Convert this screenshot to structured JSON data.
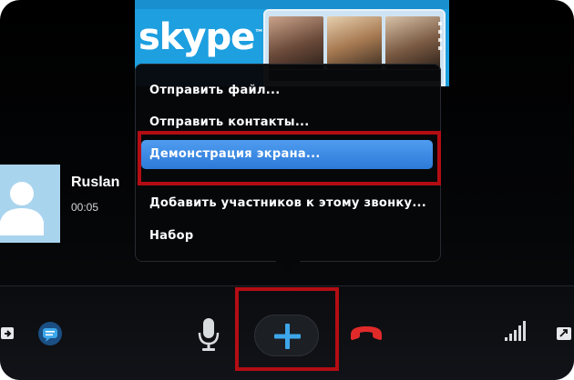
{
  "preview": {
    "logo_text": "skype",
    "logo_mark": "™"
  },
  "menu": {
    "items": [
      {
        "label": "Отправить файл..."
      },
      {
        "label": "Отправить контакты..."
      },
      {
        "label": "Демонстрация экрана...",
        "highlighted": true
      },
      {
        "label": "Добавить участников к этому звонку..."
      },
      {
        "label": "Набор"
      }
    ]
  },
  "participant": {
    "name": "Ruslan",
    "call_duration": "00:05"
  },
  "controls": {
    "icons": [
      "screen-share-icon",
      "chat-icon",
      "microphone-icon",
      "add-plus-icon",
      "hang-up-icon",
      "signal-strength-icon",
      "fullscreen-icon"
    ]
  },
  "colors": {
    "highlight": "#2c7ad8",
    "focus_box": "#b30d14",
    "add_plus": "#3da7ea",
    "hang_up": "#e02a2a",
    "avatar_bg": "#a9d4ee"
  }
}
